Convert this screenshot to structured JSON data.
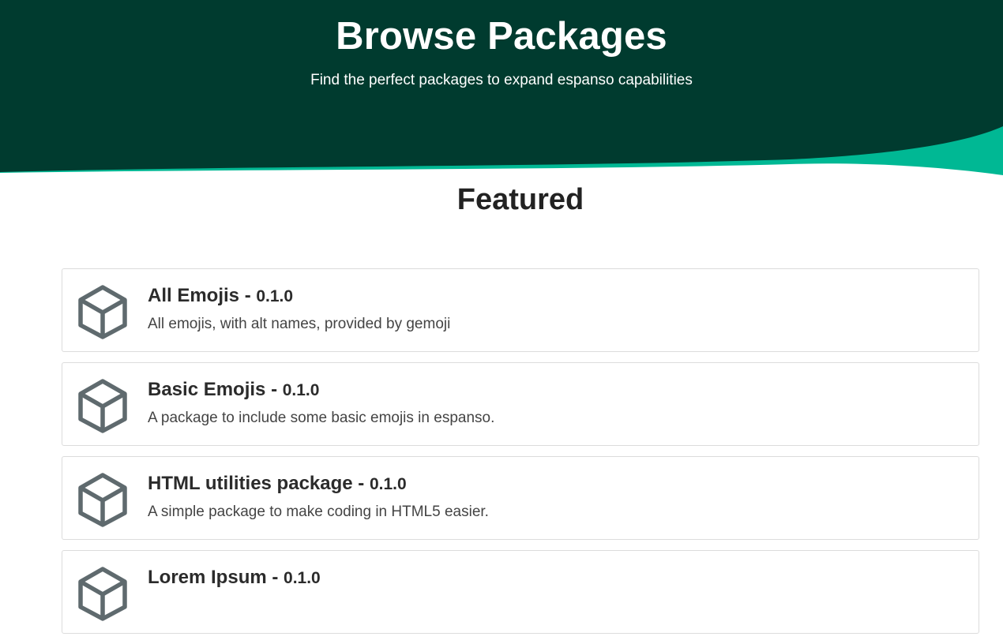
{
  "hero": {
    "title": "Browse Packages",
    "subtitle": "Find the perfect packages to expand espanso capabilities",
    "background_color": "#003b2f",
    "wave_color": "#00b894"
  },
  "featured": {
    "title": "Featured"
  },
  "packages": [
    {
      "icon": "package-box-icon",
      "name": "All Emojis",
      "separator": " - ",
      "version": "0.1.0",
      "description": "All emojis, with alt names, provided by gemoji"
    },
    {
      "icon": "package-box-icon",
      "name": "Basic Emojis",
      "separator": " - ",
      "version": "0.1.0",
      "description": "A package to include some basic emojis in espanso."
    },
    {
      "icon": "package-box-icon",
      "name": "HTML utilities package",
      "separator": " - ",
      "version": "0.1.0",
      "description": "A simple package to make coding in HTML5 easier."
    },
    {
      "icon": "package-box-icon",
      "name": "Lorem Ipsum",
      "separator": " - ",
      "version": "0.1.0",
      "description": ""
    }
  ]
}
